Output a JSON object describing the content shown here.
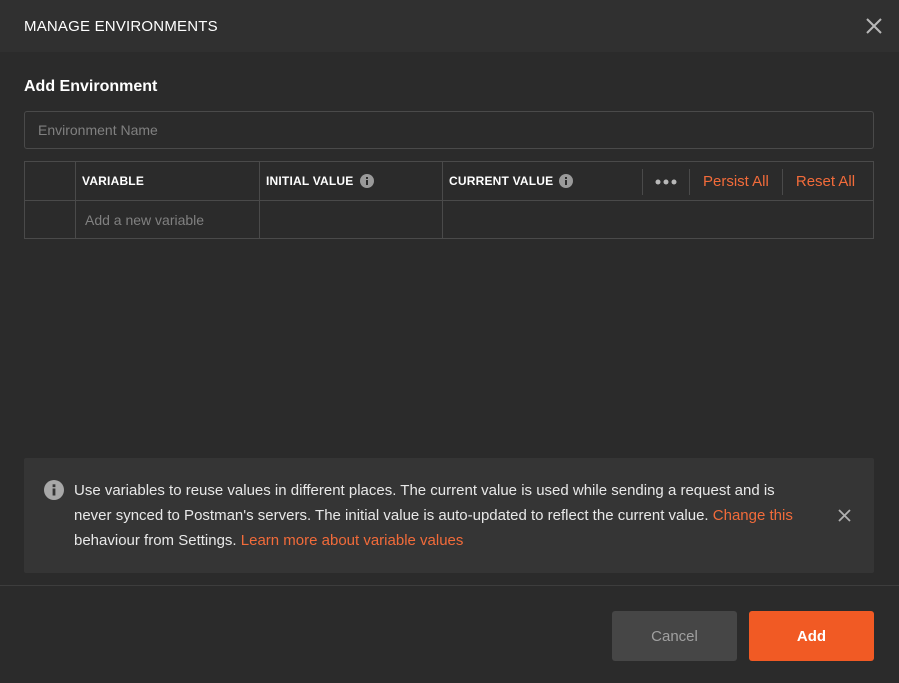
{
  "header": {
    "title": "MANAGE ENVIRONMENTS"
  },
  "form": {
    "section_title": "Add Environment",
    "env_name_placeholder": "Environment Name",
    "env_name_value": ""
  },
  "table": {
    "columns": [
      "VARIABLE",
      "INITIAL VALUE",
      "CURRENT VALUE"
    ],
    "persist_all": "Persist All",
    "reset_all": "Reset All",
    "new_variable_placeholder": "Add a new variable"
  },
  "notice": {
    "text_1": "Use variables to reuse values in different places. The current value is used while sending a request and is never synced to Postman's servers. The initial value is auto-updated to reflect the current value.",
    "change_this_link": "Change this",
    "text_2": "behaviour from Settings.",
    "learn_more_link": "Learn more about variable values"
  },
  "footer": {
    "cancel_label": "Cancel",
    "add_label": "Add"
  },
  "colors": {
    "accent": "#f26b3a",
    "primary_button": "#f15a24",
    "background": "#2b2b2b",
    "header_background": "#303030",
    "notice_background": "#353535",
    "border": "#4a4a4a"
  }
}
